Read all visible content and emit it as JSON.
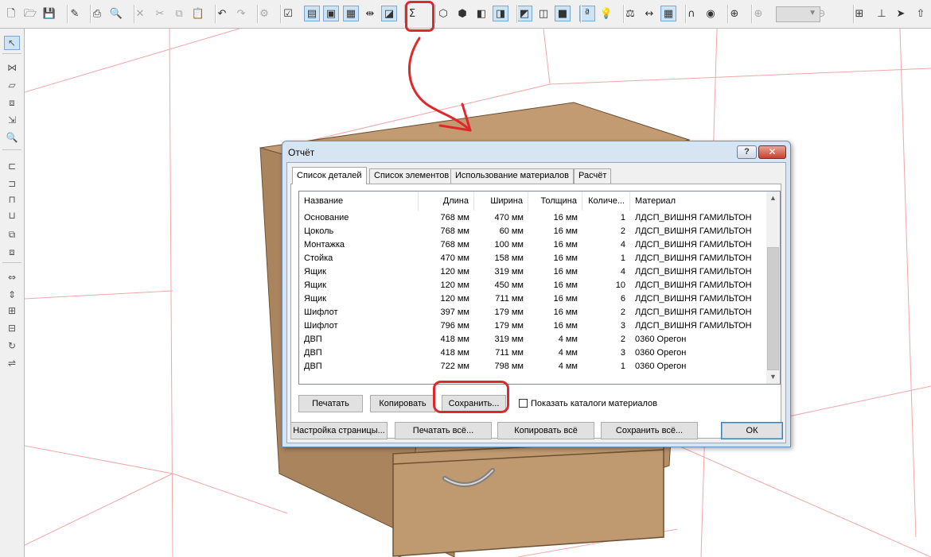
{
  "colors": {
    "highlight": "#e0282c",
    "wood": "#b08a62",
    "grid_line": "#f0a8a8",
    "dialog_frame": "#d7e4f2"
  },
  "toolbar": {
    "buttons": [
      {
        "icon": "new-document-icon",
        "glyph": "🗋"
      },
      {
        "icon": "open-folder-icon",
        "glyph": "🗁"
      },
      {
        "icon": "save-icon",
        "glyph": "💾"
      },
      {
        "icon": "edit-properties-icon",
        "glyph": "✎"
      },
      {
        "icon": "print-icon",
        "glyph": "⎙"
      },
      {
        "icon": "print-preview-icon",
        "glyph": "🔍"
      },
      {
        "icon": "delete-icon",
        "glyph": "✕"
      },
      {
        "icon": "cut-icon",
        "glyph": "✂"
      },
      {
        "icon": "copy-icon",
        "glyph": "⧉"
      },
      {
        "icon": "paste-icon",
        "glyph": "📋"
      },
      {
        "icon": "undo-icon",
        "glyph": "↶"
      },
      {
        "icon": "redo-icon",
        "glyph": "↷"
      },
      {
        "icon": "settings-icon",
        "glyph": "⚙"
      },
      {
        "icon": "checklist-icon",
        "glyph": "☑"
      },
      {
        "icon": "view-list-icon",
        "glyph": "▤"
      },
      {
        "icon": "view-detail-icon",
        "glyph": "▣"
      },
      {
        "icon": "view-tree-icon",
        "glyph": "▦"
      },
      {
        "icon": "dimension-icon",
        "glyph": "⇹"
      },
      {
        "icon": "view-object-icon",
        "glyph": "◪"
      },
      {
        "icon": "sum-report-icon",
        "glyph": "Σ"
      },
      {
        "icon": "cube-wire-icon",
        "glyph": "⬡"
      },
      {
        "icon": "cube-outline-icon",
        "glyph": "⬢"
      },
      {
        "icon": "cube-front-icon",
        "glyph": "◧"
      },
      {
        "icon": "cube-shaded-icon",
        "glyph": "◨"
      },
      {
        "icon": "cube-side-icon",
        "glyph": "◩"
      },
      {
        "icon": "cube-top-icon",
        "glyph": "◫"
      },
      {
        "icon": "cube-solid-icon",
        "glyph": "■"
      },
      {
        "icon": "text-label-icon",
        "glyph": "ª"
      },
      {
        "icon": "light-bulb-icon",
        "glyph": "💡"
      },
      {
        "icon": "measure-icon",
        "glyph": "⚖"
      },
      {
        "icon": "ruler-icon",
        "glyph": "↔"
      },
      {
        "icon": "grid-icon",
        "glyph": "▦"
      },
      {
        "icon": "magnet-icon",
        "glyph": "∩"
      },
      {
        "icon": "color-wheel-icon",
        "glyph": "◉"
      },
      {
        "icon": "target-icon",
        "glyph": "⊕"
      },
      {
        "icon": "zoom-in-icon",
        "glyph": "⊕"
      },
      {
        "icon": "zoom-out-icon",
        "glyph": "⊖"
      },
      {
        "icon": "move-grid-icon",
        "glyph": "⊞"
      },
      {
        "icon": "align-icon",
        "glyph": "⊥"
      },
      {
        "icon": "pointer-3d-icon",
        "glyph": "➤"
      },
      {
        "icon": "arrow-up-icon",
        "glyph": "⇧"
      }
    ]
  },
  "lefttoolbar": {
    "buttons": [
      {
        "icon": "select-pointer-icon",
        "glyph": "↖"
      },
      {
        "icon": "explode-icon",
        "glyph": "⋈"
      },
      {
        "icon": "panel-icon",
        "glyph": "▱"
      },
      {
        "icon": "panel-link-icon",
        "glyph": "⧈"
      },
      {
        "icon": "panel-move-icon",
        "glyph": "⇲"
      },
      {
        "icon": "search-icon",
        "glyph": "🔍"
      },
      {
        "icon": "align-left-icon",
        "glyph": "⊏"
      },
      {
        "icon": "align-right-icon",
        "glyph": "⊐"
      },
      {
        "icon": "align-top-icon",
        "glyph": "⊓"
      },
      {
        "icon": "align-bottom-icon",
        "glyph": "⊔"
      },
      {
        "icon": "group-icon",
        "glyph": "⧉"
      },
      {
        "icon": "ungroup-icon",
        "glyph": "⧈"
      },
      {
        "icon": "distribute-h-icon",
        "glyph": "⇔"
      },
      {
        "icon": "distribute-v-icon",
        "glyph": "⇕"
      },
      {
        "icon": "space-h-icon",
        "glyph": "⊞"
      },
      {
        "icon": "space-v-icon",
        "glyph": "⊟"
      },
      {
        "icon": "rotate-icon",
        "glyph": "↻"
      },
      {
        "icon": "mirror-icon",
        "glyph": "⇌"
      }
    ]
  },
  "dialog": {
    "title": "Отчёт",
    "help_label": "?",
    "close_label": "✕",
    "tabs": [
      {
        "label": "Список деталей"
      },
      {
        "label": "Список элементов"
      },
      {
        "label": "Использование материалов"
      },
      {
        "label": "Расчёт"
      }
    ],
    "table": {
      "headers": [
        "Название",
        "Длина",
        "Ширина",
        "Толщина",
        "Количе...",
        "Материал"
      ],
      "rows": [
        [
          "Основание",
          "768 мм",
          "470 мм",
          "16 мм",
          "1",
          "ЛДСП_ВИШНЯ ГАМИЛЬТОН"
        ],
        [
          "Цоколь",
          "768 мм",
          "60 мм",
          "16 мм",
          "2",
          "ЛДСП_ВИШНЯ ГАМИЛЬТОН"
        ],
        [
          "Монтажка",
          "768 мм",
          "100 мм",
          "16 мм",
          "4",
          "ЛДСП_ВИШНЯ ГАМИЛЬТОН"
        ],
        [
          "Стойка",
          "470 мм",
          "158 мм",
          "16 мм",
          "1",
          "ЛДСП_ВИШНЯ ГАМИЛЬТОН"
        ],
        [
          "Ящик",
          "120 мм",
          "319 мм",
          "16 мм",
          "4",
          "ЛДСП_ВИШНЯ ГАМИЛЬТОН"
        ],
        [
          "Ящик",
          "120 мм",
          "450 мм",
          "16 мм",
          "10",
          "ЛДСП_ВИШНЯ ГАМИЛЬТОН"
        ],
        [
          "Ящик",
          "120 мм",
          "711 мм",
          "16 мм",
          "6",
          "ЛДСП_ВИШНЯ ГАМИЛЬТОН"
        ],
        [
          "Шифлот",
          "397 мм",
          "179 мм",
          "16 мм",
          "2",
          "ЛДСП_ВИШНЯ ГАМИЛЬТОН"
        ],
        [
          "Шифлот",
          "796 мм",
          "179 мм",
          "16 мм",
          "3",
          "ЛДСП_ВИШНЯ ГАМИЛЬТОН"
        ],
        [
          "ДВП",
          "418 мм",
          "319 мм",
          "4 мм",
          "2",
          "0360 Орегон"
        ],
        [
          "ДВП",
          "418 мм",
          "711 мм",
          "4 мм",
          "3",
          "0360 Орегон"
        ],
        [
          "ДВП",
          "722 мм",
          "798 мм",
          "4 мм",
          "1",
          "0360 Орегон"
        ]
      ]
    },
    "buttons": {
      "print": "Печатать",
      "copy": "Копировать",
      "save": "Сохранить...",
      "show_catalogs": "Показать каталоги материалов",
      "page_setup": "Настройка страницы...",
      "print_all": "Печатать всё...",
      "copy_all": "Копировать всё",
      "save_all": "Сохранить всё...",
      "ok": "ОК"
    }
  }
}
